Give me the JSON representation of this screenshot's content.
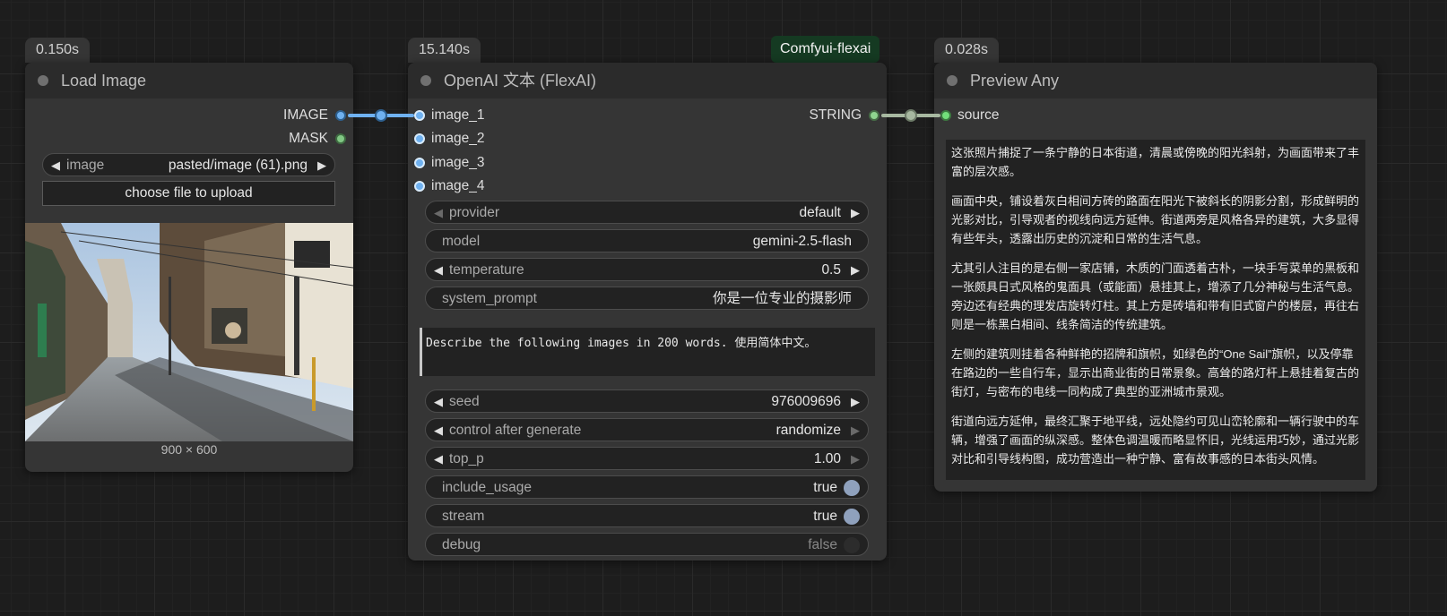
{
  "load_image_node": {
    "time": "0.150s",
    "title": "Load Image",
    "outputs": [
      "IMAGE",
      "MASK"
    ],
    "image_widget": {
      "label": "image",
      "value": "pasted/image (61).png"
    },
    "upload_button": "choose file to upload",
    "image_size": "900 × 600"
  },
  "openai_node": {
    "time": "15.140s",
    "badge": "Comfyui-flexai",
    "title": "OpenAI 文本 (FlexAI)",
    "inputs": [
      "image_1",
      "image_2",
      "image_3",
      "image_4"
    ],
    "output": "STRING",
    "widgets": {
      "provider": {
        "label": "provider",
        "value": "default"
      },
      "model": {
        "label": "model",
        "value": "gemini-2.5-flash"
      },
      "temperature": {
        "label": "temperature",
        "value": "0.5"
      },
      "system_prompt": {
        "label": "system_prompt",
        "value": "你是一位专业的摄影师"
      },
      "prompt_text": "Describe the following images in 200 words. 使用简体中文。",
      "seed": {
        "label": "seed",
        "value": "976009696"
      },
      "control_after_generate": {
        "label": "control after generate",
        "value": "randomize"
      },
      "top_p": {
        "label": "top_p",
        "value": "1.00"
      },
      "include_usage": {
        "label": "include_usage",
        "value": "true"
      },
      "stream": {
        "label": "stream",
        "value": "true"
      },
      "debug": {
        "label": "debug",
        "value": "false"
      }
    }
  },
  "preview_node": {
    "time": "0.028s",
    "title": "Preview Any",
    "input": "source",
    "paragraphs": [
      "这张照片捕捉了一条宁静的日本街道，清晨或傍晚的阳光斜射，为画面带来了丰富的层次感。",
      "画面中央，铺设着灰白相间方砖的路面在阳光下被斜长的阴影分割，形成鲜明的光影对比，引导观者的视线向远方延伸。街道两旁是风格各异的建筑，大多显得有些年头，透露出历史的沉淀和日常的生活气息。",
      "尤其引人注目的是右侧一家店铺，木质的门面透着古朴，一块手写菜单的黑板和一张颇具日式风格的鬼面具（或能面）悬挂其上，增添了几分神秘与生活气息。旁边还有经典的理发店旋转灯柱。其上方是砖墙和带有旧式窗户的楼层，再往右则是一栋黑白相间、线条简洁的传统建筑。",
      "左侧的建筑则挂着各种鲜艳的招牌和旗帜，如绿色的“One Sail”旗帜，以及停靠在路边的一些自行车，显示出商业街的日常景象。高耸的路灯杆上悬挂着复古的街灯，与密布的电线一同构成了典型的亚洲城市景观。",
      "街道向远方延伸，最终汇聚于地平线，远处隐约可见山峦轮廓和一辆行驶中的车辆，增强了画面的纵深感。整体色调温暖而略显怀旧，光线运用巧妙，通过光影对比和引导线构图，成功营造出一种宁静、富有故事感的日本街头风情。"
    ]
  },
  "colors": {
    "image_link": "#6fb1f0",
    "string_link": "#a7b8a0",
    "badge_bg": "#153a22"
  }
}
